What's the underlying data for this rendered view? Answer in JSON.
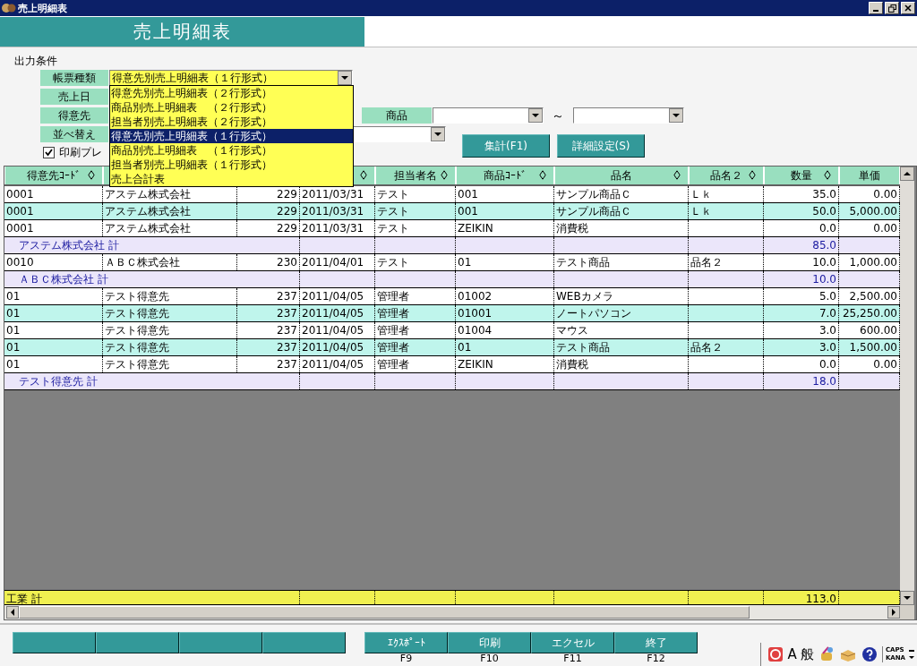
{
  "window": {
    "title": "売上明細表"
  },
  "header": {
    "title": "売上明細表"
  },
  "conditions": {
    "heading": "出力条件",
    "report_type": {
      "label": "帳票種類",
      "value": "得意先別売上明細表（１行形式）",
      "expanded": true,
      "options": [
        {
          "label": "得意先別売上明細表（２行形式）",
          "selected": false
        },
        {
          "label": "商品別売上明細表　（２行形式）",
          "selected": false
        },
        {
          "label": "担当者別売上明細表（２行形式）",
          "selected": false
        },
        {
          "label": "得意先別売上明細表（１行形式）",
          "selected": true
        },
        {
          "label": "商品別売上明細表　（１行形式）",
          "selected": false
        },
        {
          "label": "担当者別売上明細表（１行形式）",
          "selected": false
        },
        {
          "label": "売上合計表",
          "selected": false
        }
      ]
    },
    "sales_date": {
      "label": "売上日"
    },
    "customer": {
      "label": "得意先"
    },
    "product": {
      "label": "商品",
      "separator": "～"
    },
    "sort": {
      "label": "並べ替え"
    },
    "print_preview": {
      "label": "印刷プレ",
      "checked": true
    }
  },
  "buttons": [
    {
      "label": "集計(F1)"
    },
    {
      "label": "詳細設定(S)"
    }
  ],
  "table": {
    "columns": [
      {
        "label": "得意先ｺｰﾄﾞ",
        "sortable": true
      },
      {},
      {},
      {
        "sortable": true
      },
      {
        "label": "担当者名",
        "sortable": true
      },
      {
        "label": "商品ｺｰﾄﾞ",
        "sortable": true
      },
      {
        "label": "品名",
        "sortable": true
      },
      {
        "label": "品名２",
        "sortable": true
      },
      {
        "label": "数量",
        "sortable": true
      },
      {
        "label": "単価",
        "sortable": false
      }
    ],
    "rows": [
      {
        "kind": "detail",
        "shaded": false,
        "cells": [
          "0001",
          "アステム株式会社",
          "229",
          "2011/03/31",
          "テスト",
          "001",
          "サンプル商品Ｃ",
          "Ｌｋ",
          "35.0",
          "0.00"
        ]
      },
      {
        "kind": "detail",
        "shaded": true,
        "cells": [
          "0001",
          "アステム株式会社",
          "229",
          "2011/03/31",
          "テスト",
          "001",
          "サンプル商品Ｃ",
          "Ｌｋ",
          "50.0",
          "5,000.00"
        ]
      },
      {
        "kind": "detail",
        "shaded": false,
        "cells": [
          "0001",
          "アステム株式会社",
          "229",
          "2011/03/31",
          "テスト",
          "ZEIKIN",
          "消費税",
          "",
          "0.0",
          "0.00"
        ]
      },
      {
        "kind": "subtotal",
        "label": "アステム株式会社 計",
        "quantity": "85.0"
      },
      {
        "kind": "detail",
        "shaded": false,
        "cells": [
          "0010",
          "ＡＢＣ株式会社",
          "230",
          "2011/04/01",
          "テスト",
          "01",
          "テスト商品",
          "品名２",
          "10.0",
          "1,000.00"
        ]
      },
      {
        "kind": "subtotal",
        "label": "ＡＢＣ株式会社 計",
        "quantity": "10.0"
      },
      {
        "kind": "detail",
        "shaded": false,
        "cells": [
          "01",
          "テスト得意先",
          "237",
          "2011/04/05",
          "管理者",
          "01002",
          "WEBカメラ",
          "",
          "5.0",
          "2,500.00"
        ]
      },
      {
        "kind": "detail",
        "shaded": true,
        "cells": [
          "01",
          "テスト得意先",
          "237",
          "2011/04/05",
          "管理者",
          "01001",
          "ノートパソコン",
          "",
          "7.0",
          "25,250.00"
        ]
      },
      {
        "kind": "detail",
        "shaded": false,
        "cells": [
          "01",
          "テスト得意先",
          "237",
          "2011/04/05",
          "管理者",
          "01004",
          "マウス",
          "",
          "3.0",
          "600.00"
        ]
      },
      {
        "kind": "detail",
        "shaded": true,
        "cells": [
          "01",
          "テスト得意先",
          "237",
          "2011/04/05",
          "管理者",
          "01",
          "テスト商品",
          "品名２",
          "3.0",
          "1,500.00"
        ]
      },
      {
        "kind": "detail",
        "shaded": false,
        "cells": [
          "01",
          "テスト得意先",
          "237",
          "2011/04/05",
          "管理者",
          "ZEIKIN",
          "消費税",
          "",
          "0.0",
          "0.00"
        ]
      },
      {
        "kind": "subtotal",
        "label": "テスト得意先 計",
        "quantity": "18.0"
      }
    ],
    "total": {
      "label": "工業 計",
      "quantity": "113.0"
    }
  },
  "function_keys": [
    {
      "kind": "blank"
    },
    {
      "kind": "blank"
    },
    {
      "kind": "blank"
    },
    {
      "kind": "blank"
    },
    {
      "kind": "command",
      "label": "ｴｸｽﾎﾟｰﾄ",
      "key": "F9"
    },
    {
      "kind": "command",
      "label": "印刷",
      "key": "F10"
    },
    {
      "kind": "command",
      "label": "エクセル",
      "key": "F11"
    },
    {
      "kind": "command",
      "label": "終了",
      "key": "F12"
    }
  ],
  "tray": {
    "ime_mode": "A",
    "ime_input": "般",
    "caps": "CAPS",
    "kana": "KANA"
  }
}
